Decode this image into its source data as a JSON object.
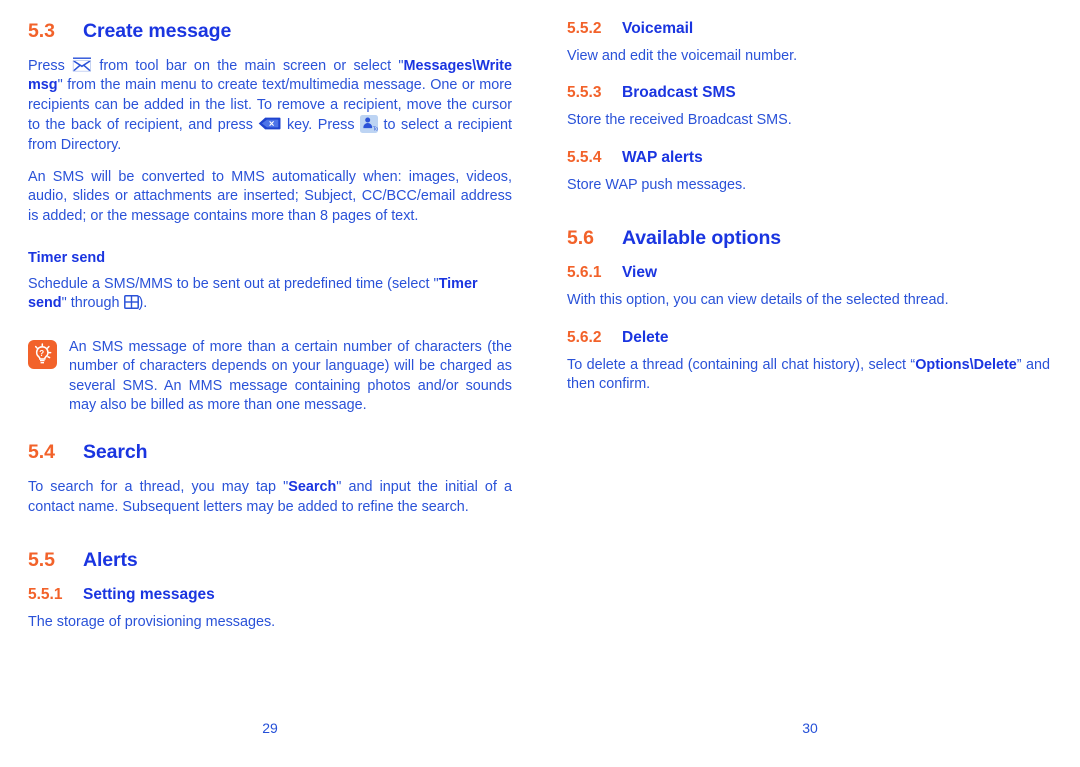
{
  "document": {
    "type": "user-manual-page-spread",
    "colors": {
      "section_number": "#f2622a",
      "heading": "#1a35e0",
      "body": "#2a52d8",
      "tip_background": "#f2622a",
      "tip_glyph": "#ffffff",
      "contact_icon_background": "#bcd3f2",
      "page_background": "#ffffff"
    }
  },
  "left_page": {
    "folio": "29",
    "sections": {
      "create_message": {
        "number": "5.3",
        "title": "Create message",
        "para1": {
          "t1": "Press ",
          "icon1": "envelope-icon",
          "t2": " from tool bar on the main screen or select \"",
          "b1": "Messages\\Write msg",
          "t3": "\" from the main menu to create text/multimedia message. One or more recipients can be added in the list. To remove a recipient, move the cursor to the back of recipient, and press ",
          "icon2": "backspace-key-icon",
          "t4": " key. Press ",
          "icon3": "contact-to-icon",
          "t5": " to select a recipient from Directory."
        },
        "para2": "An SMS will be converted to MMS automatically when: images, videos, audio, slides or attachments are inserted; Subject, CC/BCC/email address is added; or the message contains more than 8 pages of text."
      },
      "timer_send": {
        "title": "Timer send",
        "para": {
          "t1": "Schedule a SMS/MMS to be sent out at predefined time (select \"",
          "b1": "Timer send",
          "t2": "\" through ",
          "icon1": "grid-menu-icon",
          "t3": ")."
        }
      },
      "tip": {
        "icon": "lightbulb-tip-icon",
        "text": "An SMS message of more than a certain number of characters (the number of characters depends on your language) will be charged as several SMS. An MMS message containing photos and/or sounds may also be billed as more than one message."
      },
      "search": {
        "number": "5.4",
        "title": "Search",
        "para": {
          "t1": "To search for a thread, you may tap \"",
          "b1": "Search",
          "t2": "\" and input the initial of a contact name. Subsequent letters may be added to refine the search."
        }
      },
      "alerts": {
        "number": "5.5",
        "title": "Alerts",
        "setting_messages": {
          "number": "5.5.1",
          "title": "Setting messages",
          "para": "The storage of provisioning messages."
        }
      }
    }
  },
  "right_page": {
    "folio": "30",
    "sections": {
      "voicemail": {
        "number": "5.5.2",
        "title": "Voicemail",
        "para": "View and edit the voicemail number."
      },
      "broadcast_sms": {
        "number": "5.5.3",
        "title": "Broadcast SMS",
        "para": "Store the received Broadcast SMS."
      },
      "wap_alerts": {
        "number": "5.5.4",
        "title": "WAP alerts",
        "para": "Store WAP push messages."
      },
      "available_options": {
        "number": "5.6",
        "title": "Available options",
        "view": {
          "number": "5.6.1",
          "title": "View",
          "para": "With this option, you can view details of the selected thread."
        },
        "delete": {
          "number": "5.6.2",
          "title": "Delete",
          "para": {
            "t1": "To delete a thread (containing all chat history), select “",
            "b1": "Options\\Delete",
            "t2": "” and then confirm."
          }
        }
      }
    }
  }
}
